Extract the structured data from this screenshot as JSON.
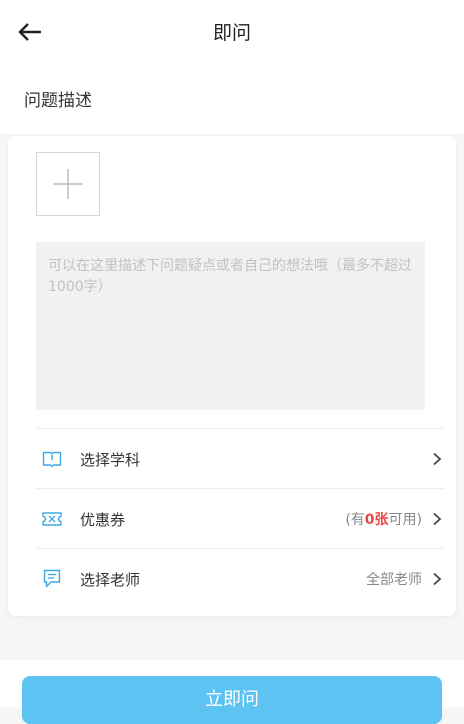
{
  "header": {
    "title": "即问",
    "back_icon": "arrow-left-icon"
  },
  "section": {
    "title": "问题描述"
  },
  "form": {
    "add_photo_icon": "plus-icon",
    "description_placeholder": "可以在这里描述下问题疑点或者自己的想法哦（最多不超过1000字）",
    "description_value": ""
  },
  "rows": {
    "subject": {
      "label": "选择学科",
      "icon": "book-icon",
      "value": ""
    },
    "coupon": {
      "label": "优惠券",
      "icon": "ticket-icon",
      "prefix": "(有",
      "count": "0张",
      "suffix": "可用)"
    },
    "teacher": {
      "label": "选择老师",
      "icon": "chat-icon",
      "value": "全部老师"
    }
  },
  "submit": {
    "label": "立即问"
  },
  "colors": {
    "accent": "#3ea8e6",
    "submit_bg": "#5cc3f2",
    "coupon_count": "#e64646"
  }
}
